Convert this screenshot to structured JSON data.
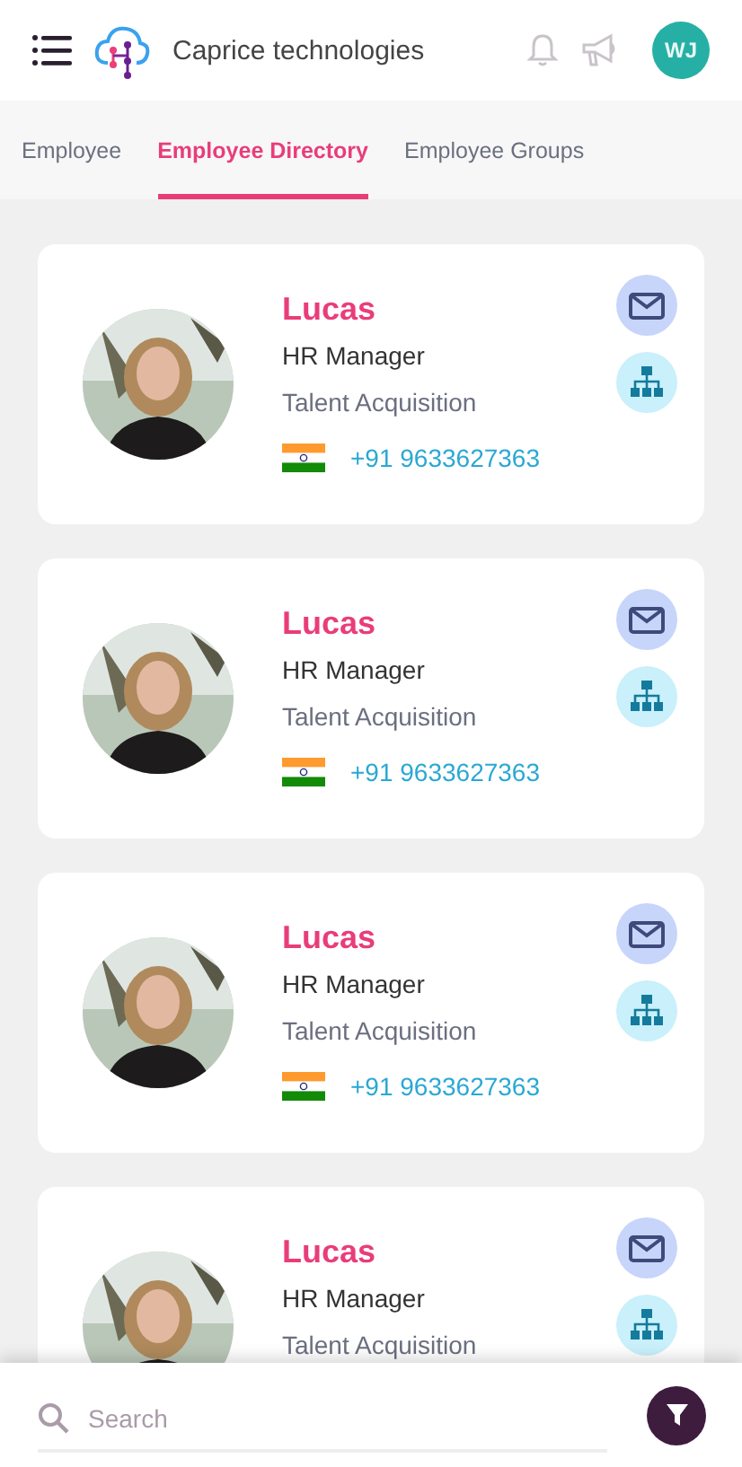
{
  "header": {
    "brand": "Caprice technologies",
    "avatar_initials": "WJ"
  },
  "tabs": [
    {
      "label": "Employee",
      "selected": false
    },
    {
      "label": "Employee Directory",
      "selected": true
    },
    {
      "label": "Employee Groups",
      "selected": false
    }
  ],
  "employees": [
    {
      "name": "Lucas",
      "title": "HR Manager",
      "department": "Talent Acquisition",
      "phone": "+91 9633627363"
    },
    {
      "name": "Lucas",
      "title": "HR Manager",
      "department": "Talent Acquisition",
      "phone": "+91 9633627363"
    },
    {
      "name": "Lucas",
      "title": "HR Manager",
      "department": "Talent Acquisition",
      "phone": "+91 9633627363"
    },
    {
      "name": "Lucas",
      "title": "HR Manager",
      "department": "Talent Acquisition"
    }
  ],
  "search": {
    "placeholder": "Search"
  }
}
